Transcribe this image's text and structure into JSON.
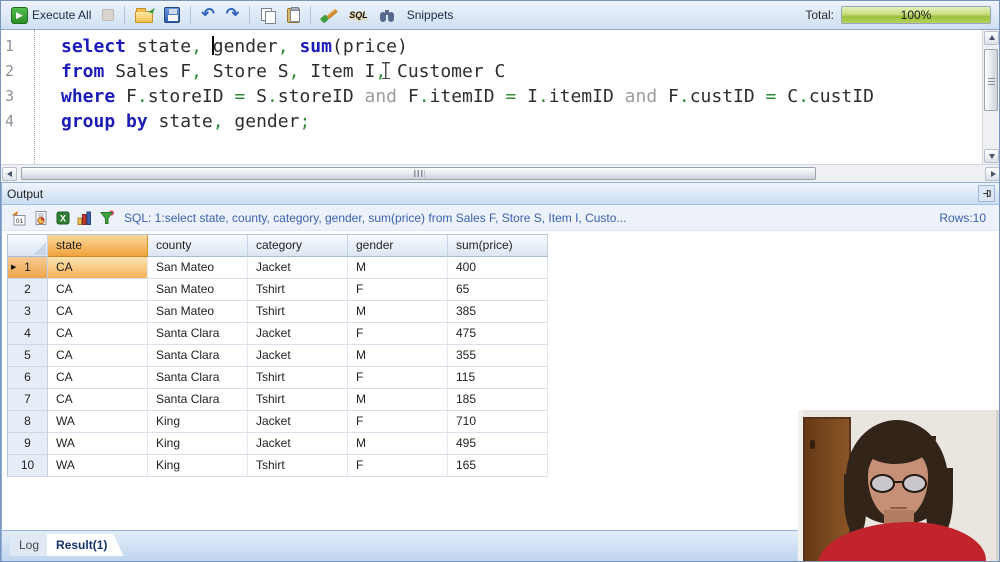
{
  "toolbar": {
    "execute_all": "Execute All",
    "snippets": "Snippets",
    "total_label": "Total:",
    "progress": "100%",
    "icons": {
      "execute": "▶",
      "undo": "↶",
      "redo": "↷",
      "sql": "SQL"
    }
  },
  "editor": {
    "lines": [
      {
        "num": "1",
        "segments": [
          {
            "t": "select",
            "c": "kw"
          },
          {
            "t": " state",
            "c": "id"
          },
          {
            "t": ",",
            "c": "op"
          },
          {
            "t": " ",
            "c": "id"
          },
          {
            "caret": true
          },
          {
            "t": "gender",
            "c": "id"
          },
          {
            "t": ",",
            "c": "op"
          },
          {
            "t": " ",
            "c": "id"
          },
          {
            "t": "sum",
            "c": "kw"
          },
          {
            "t": "(price)",
            "c": "id"
          }
        ]
      },
      {
        "num": "2",
        "segments": [
          {
            "t": "from",
            "c": "kw"
          },
          {
            "t": " Sales F",
            "c": "id"
          },
          {
            "t": ",",
            "c": "op"
          },
          {
            "t": " Store S",
            "c": "id"
          },
          {
            "t": ",",
            "c": "op"
          },
          {
            "t": " Item I",
            "c": "id"
          },
          {
            "t": ",",
            "c": "op"
          },
          {
            "ibeam": true
          },
          {
            "t": " Customer C",
            "c": "id"
          }
        ]
      },
      {
        "num": "3",
        "segments": [
          {
            "t": "where",
            "c": "kw"
          },
          {
            "t": " F",
            "c": "id"
          },
          {
            "t": ".",
            "c": "op"
          },
          {
            "t": "storeID ",
            "c": "id"
          },
          {
            "t": "=",
            "c": "op"
          },
          {
            "t": " S",
            "c": "id"
          },
          {
            "t": ".",
            "c": "op"
          },
          {
            "t": "storeID ",
            "c": "id"
          },
          {
            "t": "and",
            "c": "gy"
          },
          {
            "t": " F",
            "c": "id"
          },
          {
            "t": ".",
            "c": "op"
          },
          {
            "t": "itemID ",
            "c": "id"
          },
          {
            "t": "=",
            "c": "op"
          },
          {
            "t": " I",
            "c": "id"
          },
          {
            "t": ".",
            "c": "op"
          },
          {
            "t": "itemID ",
            "c": "id"
          },
          {
            "t": "and",
            "c": "gy"
          },
          {
            "t": " F",
            "c": "id"
          },
          {
            "t": ".",
            "c": "op"
          },
          {
            "t": "custID ",
            "c": "id"
          },
          {
            "t": "=",
            "c": "op"
          },
          {
            "t": " C",
            "c": "id"
          },
          {
            "t": ".",
            "c": "op"
          },
          {
            "t": "custID",
            "c": "id"
          }
        ]
      },
      {
        "num": "4",
        "segments": [
          {
            "t": "group by",
            "c": "kw"
          },
          {
            "t": " state",
            "c": "id"
          },
          {
            "t": ",",
            "c": "op"
          },
          {
            "t": " gender",
            "c": "id"
          },
          {
            "t": ";",
            "c": "op"
          }
        ]
      }
    ]
  },
  "output": {
    "title": "Output",
    "status_sql": "SQL: 1:select state, county, category, gender, sum(price)  from Sales F, Store S, Item I, Custo...",
    "rows_label": "Rows:10",
    "icon_labels": {
      "grid_export": "01",
      "excel": "X"
    },
    "icons": [
      "export-result-icon",
      "report-icon",
      "excel-export-icon",
      "chart-icon",
      "filter-icon"
    ]
  },
  "grid": {
    "columns": [
      "state",
      "county",
      "category",
      "gender",
      "sum(price)"
    ],
    "rows": [
      [
        "CA",
        "San Mateo",
        "Jacket",
        "M",
        "400"
      ],
      [
        "CA",
        "San Mateo",
        "Tshirt",
        "F",
        "65"
      ],
      [
        "CA",
        "San Mateo",
        "Tshirt",
        "M",
        "385"
      ],
      [
        "CA",
        "Santa Clara",
        "Jacket",
        "F",
        "475"
      ],
      [
        "CA",
        "Santa Clara",
        "Jacket",
        "M",
        "355"
      ],
      [
        "CA",
        "Santa Clara",
        "Tshirt",
        "F",
        "115"
      ],
      [
        "CA",
        "Santa Clara",
        "Tshirt",
        "M",
        "185"
      ],
      [
        "WA",
        "King",
        "Jacket",
        "F",
        "710"
      ],
      [
        "WA",
        "King",
        "Jacket",
        "M",
        "495"
      ],
      [
        "WA",
        "King",
        "Tshirt",
        "F",
        "165"
      ]
    ],
    "selected_column": "state",
    "selected_row": 1,
    "row_marker": "▶"
  },
  "tabs": [
    {
      "label": "Log",
      "active": false
    },
    {
      "label": "Result(1)",
      "active": true
    }
  ],
  "colors": {
    "keyword_blue": "#1b1bb8",
    "operator_green": "#2e8b3a",
    "and_gray": "#9c9c9c",
    "selection_orange": "#f0a23c",
    "status_blue": "#3a62b0",
    "progress_green": "#9cc03e",
    "shirt_red": "#c2242e"
  }
}
